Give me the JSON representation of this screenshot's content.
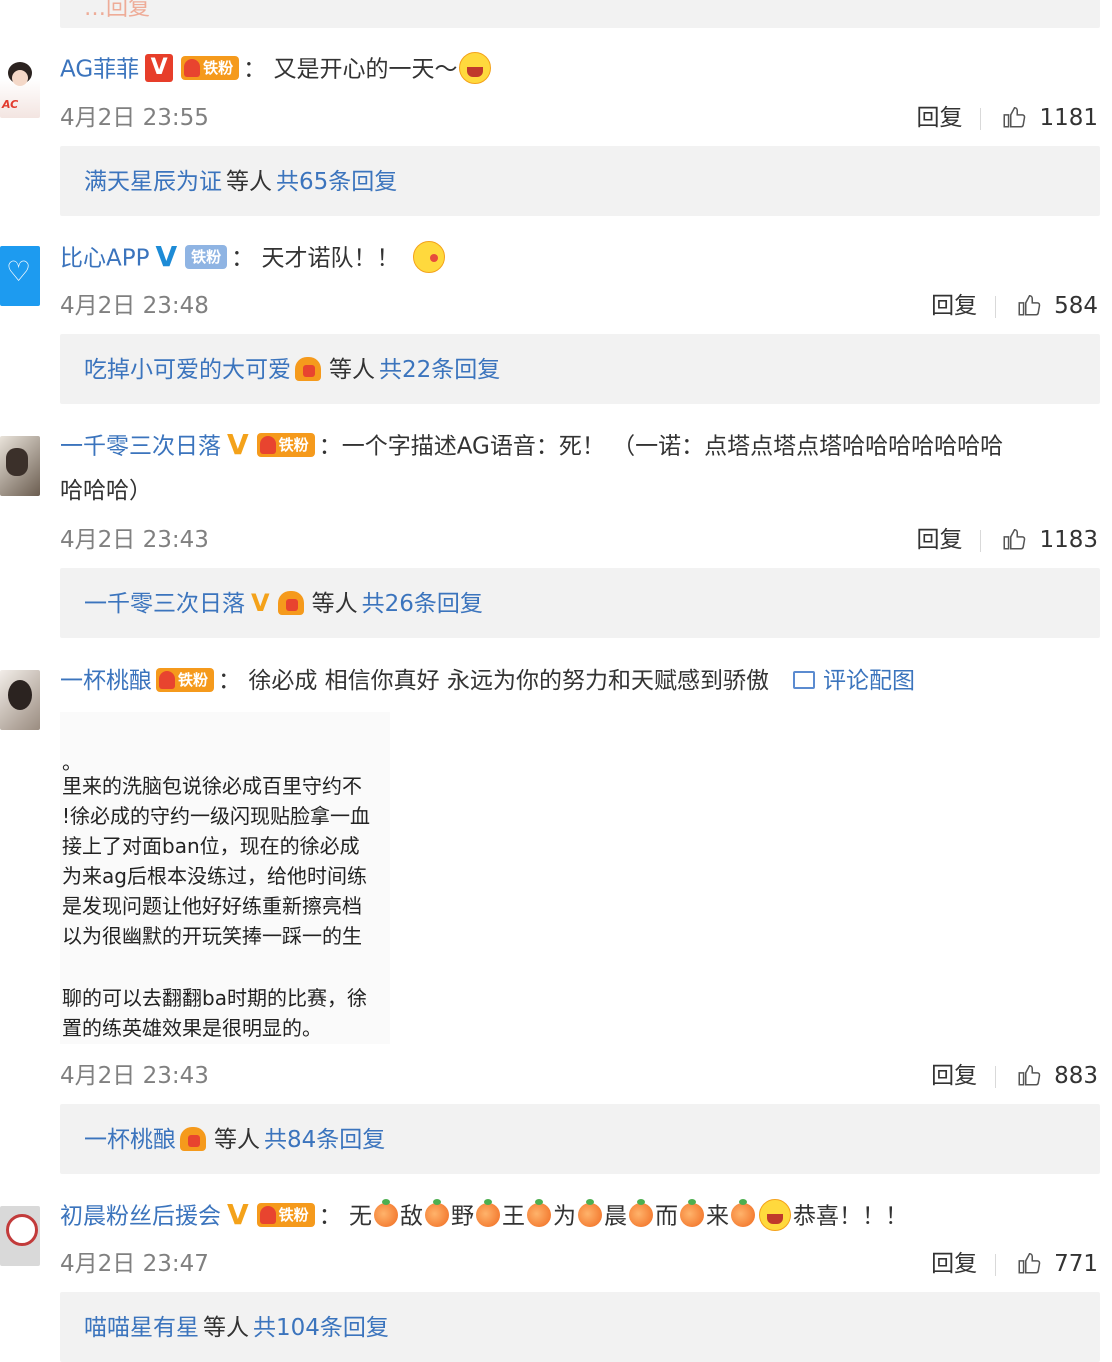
{
  "top": {
    "fragment": "…回复"
  },
  "comments": [
    {
      "user": "AG菲菲",
      "badge": "V",
      "fan": "铁粉",
      "text": "又是开心的一天～",
      "time": "4月2日 23:55",
      "reply": "回复",
      "likes": "1181",
      "replies": {
        "who": "满天星辰为证",
        "mid": "等人",
        "count": "共65条回复"
      }
    },
    {
      "user": "比心APP",
      "badge": "V",
      "fan": "铁粉",
      "text": "天才诺队！！",
      "time": "4月2日 23:48",
      "reply": "回复",
      "likes": "584",
      "replies": {
        "who": "吃掉小可爱的大可爱",
        "mid": "等人",
        "count": "共22条回复"
      }
    },
    {
      "user": "一千零三次日落",
      "badge": "V",
      "fan": "铁粉",
      "text": "一个字描述AG语音：死！ （一诺：点塔点塔点塔哈哈哈哈哈哈哈",
      "text2": "哈哈哈）",
      "time": "4月2日 23:43",
      "reply": "回复",
      "likes": "1183",
      "replies": {
        "who": "一千零三次日落",
        "mid": "等人",
        "count": "共26条回复"
      }
    },
    {
      "user": "一杯桃酿",
      "fan": "铁粉",
      "text": "徐必成 相信你真好 永远为你的努力和天赋感到骄傲",
      "pic_link": "评论配图",
      "image_lines": [
        "。",
        "里来的洗脑包说徐必成百里守约不",
        "!徐必成的守约一级闪现贴脸拿一血",
        "接上了对面ban位，现在的徐必成",
        "为来ag后根本没练过，给他时间练",
        "是发现问题让他好好练重新擦亮档",
        "以为很幽默的开玩笑捧一踩一的生",
        "",
        "聊的可以去翻翻ba时期的比赛，徐",
        "置的练英雄效果是很明显的。"
      ],
      "time": "4月2日 23:43",
      "reply": "回复",
      "likes": "883",
      "replies": {
        "who": "一杯桃酿",
        "mid": "等人",
        "count": "共84条回复"
      }
    },
    {
      "user": "初晨粉丝后援会",
      "badge": "V",
      "fan": "铁粉",
      "text_chars": [
        "无",
        "敌",
        "野",
        "王",
        "为",
        "晨",
        "而",
        "来"
      ],
      "text_tail": "恭喜！！！",
      "time": "4月2日 23:47",
      "reply": "回复",
      "likes": "771",
      "replies": {
        "who": "喵喵星有星",
        "mid": "等人",
        "count": "共104条回复"
      }
    }
  ],
  "icons": {
    "like": "thumbs-up-icon",
    "picture": "picture-icon"
  },
  "colors": {
    "link": "#3b74bd",
    "text": "#333333",
    "meta": "#808080",
    "reply_bg": "#f2f2f2",
    "vip_red": "#e73e2a",
    "v_blue": "#1d8bd6",
    "v_gold": "#f4a21a",
    "fan_orange": "#f59a1c"
  }
}
